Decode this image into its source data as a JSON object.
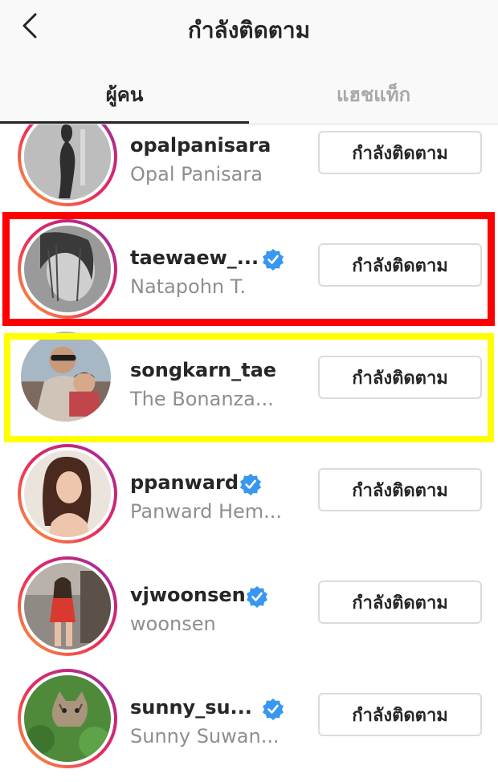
{
  "header": {
    "title": "กำลังติดตาม",
    "back_icon": "chevron-left-icon"
  },
  "tabs": [
    {
      "label": "ผู้คน",
      "active": true
    },
    {
      "label": "แฮชแท็ก",
      "active": false
    }
  ],
  "colors": {
    "highlight_red": "#ff0000",
    "highlight_yellow": "#ffff00",
    "verified_blue": "#3897f0",
    "story_ring": [
      "#f9a23a",
      "#ee2a5a",
      "#8a35b9"
    ]
  },
  "accounts": [
    {
      "username": "opalpanisara",
      "full_name": "Opal Panisara",
      "verified": false,
      "button_label": "กำลังติดตาม"
    },
    {
      "username": "taewaew_...",
      "full_name": "Natapohn T.",
      "verified": true,
      "button_label": "กำลังติดตาม"
    },
    {
      "username": "songkarn_tae",
      "full_name": "The Bonanza...",
      "verified": false,
      "button_label": "กำลังติดตาม"
    },
    {
      "username": "ppanward",
      "full_name": "Panward Hem...",
      "verified": true,
      "button_label": "กำลังติดตาม"
    },
    {
      "username": "vjwoonsen",
      "full_name": "woonsen",
      "verified": true,
      "button_label": "กำลังติดตาม"
    },
    {
      "username": "sunny_su...",
      "full_name": "Sunny Suwan...",
      "verified": true,
      "button_label": "กำลังติดตาม"
    }
  ]
}
